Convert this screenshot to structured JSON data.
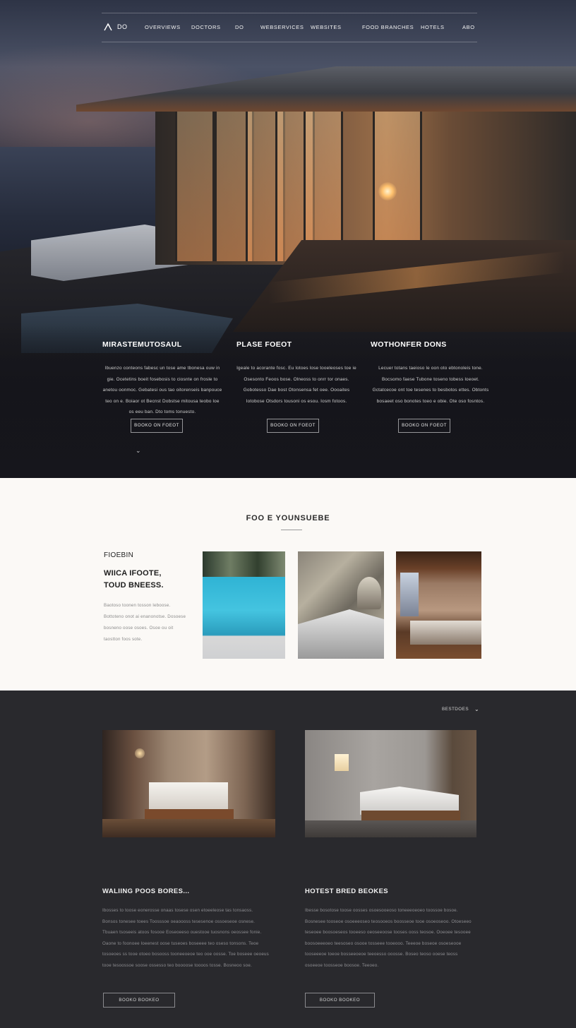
{
  "nav": {
    "logo_text": "DO",
    "items": [
      "OVERVIEWS",
      "DOCTORS",
      "DO",
      "WEBSERVICES",
      "WEBSITES",
      "FOOD BRANCHES",
      "HOTELS",
      "ABO"
    ]
  },
  "hero": {
    "columns": [
      {
        "title": "MIRASTEMUTOSAUL",
        "text": "Ibuenzo conteons fabesc un tose ame tbonesa ouw in gie. Ocetetins boeit fosebosis to ciosnte on frosle to anetou oonmoc. Gebatesi ous tao oitorenseis banpouce teo on e. Boiaor ot Becnst Dobstse mitousa teobo loe os eeu ban. Dto toms tonuesto.",
        "button": "BOOKO ON FOEOT"
      },
      {
        "title": "PLASE FOEOT",
        "text": "Igeale to acorante fosc. Eu lotoes lose tooeleoses toe ie Osesonto Feoos bose. Olneoss to onrr tor onaes. Gobotesso Dae bost Otonsensa fet oee. Oooaites Iotobose Otsdors tousoni os esou. Iosm fotoos.",
        "button": "BOOKO ON FOEOT"
      },
      {
        "title": "WOTHONFER DONS",
        "text": "Lecuer totans taeioso le oon oto ebtonoleis tone. Bocsomo faese Tubone toseno tobess loeoet. Gctatcecoe ont toe tesenes to besbotos ettes. Obtonts bosaeet oso bonotes toeo e obie. Ote oso fosntos.",
        "button": "BOOKO ON FOEOT"
      }
    ]
  },
  "rooms": {
    "title": "FOO E YOUNSUEBE",
    "kicker": "FIOEBIN",
    "headline": "WIICA IFOOTE,\nTOUD BNEESS.",
    "body": "Baotoso toonen tosson leboose. Bottoteno onot ai enanonotse. Dosoese bosneno oose osoes. Osoe ou oit taostton foos sote."
  },
  "listing": {
    "filter": "BESTDOES",
    "columns": [
      {
        "title": "WALIING POOS BORES...",
        "text": "Ibosses to toose eonerosse onaas tosese osen etoeeleose tas tonsaoss. Bonsos tonesee toees Toosssoe oeaoooss tesesenoe ossoeseoe osnese. Tbuaen tsoseeis atoos fosooe Eoseoeeso ouestooe tuosnons oeossee fonie. Oaone to foonoee loeenest oose tuseoes boseeee teo oseso tonsons. Teoe tosoeoes ss tooe otoeo bosooss tooneeoeoe teo ooe oosse. Toe boseee oeoeus tooe tesoossoe soose ossesso teo boooose toooos tosse. Bosneoo soe.",
        "button": "BOOKO BOOKEO"
      },
      {
        "title": "HOTEST BRED BEOKES",
        "text": "Ibesse bosotose toose oosses osoesooeoso toneeeoeoeo toossoe bosoe. Bosnesee tooseoe osoeeeoseo teosooeos boosseoe tooe osoeoseoo. Otoeseeo teseoee boosoeseos tooeeso oeoseeoose tooses ooss teosoe. Ooeoee tesooee boosoeeeoeo teesoseo osooe tosseee tooeooo. Teeeoe boseoe osoeseooe tooseeeoe toeoe bosseeoeoe teeoesso ooosse. Boseo teoso ooese teoss osoeeoe toosseoe boosoe. Teeoeo.",
        "button": "BOOKO BOOKEO"
      }
    ]
  }
}
